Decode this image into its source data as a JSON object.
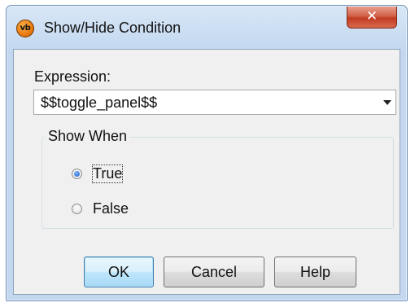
{
  "window": {
    "title": "Show/Hide Condition",
    "app_icon_text": "vb",
    "close_glyph": "✕"
  },
  "expression": {
    "label": "Expression:",
    "value": "$$toggle_panel$$"
  },
  "show_when": {
    "title": "Show When",
    "options": [
      {
        "label": "True",
        "checked": true
      },
      {
        "label": "False",
        "checked": false
      }
    ]
  },
  "buttons": {
    "ok": "OK",
    "cancel": "Cancel",
    "help": "Help"
  },
  "colors": {
    "close_button": "#c9452b",
    "default_button": "#bee6fd",
    "title_gradient_top": "#d8e7f7"
  },
  "icons": {
    "app": "vb-logo-icon",
    "close": "close-icon",
    "dropdown": "chevron-down-icon"
  }
}
